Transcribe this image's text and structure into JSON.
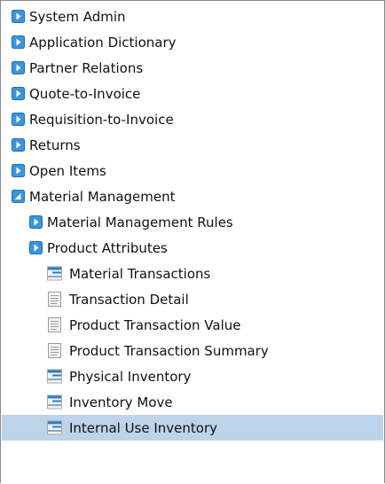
{
  "tree": {
    "items": [
      {
        "label": "System Admin",
        "icon": "folder-collapsed-icon",
        "level": 0
      },
      {
        "label": "Application Dictionary",
        "icon": "folder-collapsed-icon",
        "level": 0
      },
      {
        "label": "Partner Relations",
        "icon": "folder-collapsed-icon",
        "level": 0
      },
      {
        "label": "Quote-to-Invoice",
        "icon": "folder-collapsed-icon",
        "level": 0
      },
      {
        "label": "Requisition-to-Invoice",
        "icon": "folder-collapsed-icon",
        "level": 0
      },
      {
        "label": "Returns",
        "icon": "folder-collapsed-icon",
        "level": 0
      },
      {
        "label": "Open Items",
        "icon": "folder-collapsed-icon",
        "level": 0
      },
      {
        "label": "Material Management",
        "icon": "folder-expanded-icon",
        "level": 0
      },
      {
        "label": "Material Management Rules",
        "icon": "folder-collapsed-icon",
        "level": 1
      },
      {
        "label": "Product Attributes",
        "icon": "folder-collapsed-icon",
        "level": 1
      },
      {
        "label": "Material Transactions",
        "icon": "window-icon",
        "level": 2
      },
      {
        "label": "Transaction Detail",
        "icon": "report-icon",
        "level": 2
      },
      {
        "label": "Product Transaction Value",
        "icon": "report-icon",
        "level": 2
      },
      {
        "label": "Product Transaction Summary",
        "icon": "report-icon",
        "level": 2
      },
      {
        "label": "Physical Inventory",
        "icon": "window-icon",
        "level": 2
      },
      {
        "label": "Inventory Move",
        "icon": "window-icon",
        "level": 2
      },
      {
        "label": "Internal Use Inventory",
        "icon": "window-icon",
        "level": 2,
        "selected": true
      }
    ]
  },
  "colors": {
    "selection": "#bcd4ea",
    "folder": "#3b95dc",
    "window_bar": "#2c7dc9"
  }
}
